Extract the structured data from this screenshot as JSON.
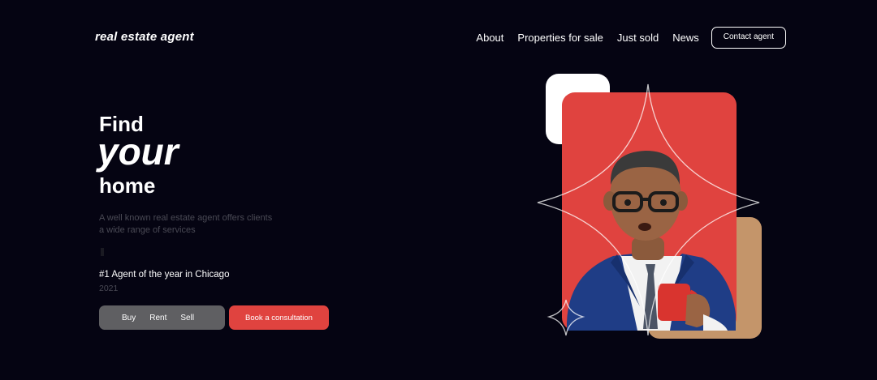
{
  "header": {
    "logo": "real estate agent",
    "nav": [
      "About",
      "Properties for sale",
      "Just sold",
      "News"
    ],
    "contact_label": "Contact agent"
  },
  "hero": {
    "line1": "Find",
    "line2": "your",
    "line3": "home",
    "description": "A well known real estate agent offers clients a wide range of services",
    "award": "#1 Agent of the year in Chicago",
    "award_year": "2021"
  },
  "filters": [
    "Buy",
    "Rent",
    "Sell"
  ],
  "cta_label": "Book a consultation",
  "colors": {
    "background": "#050412",
    "accent": "#e0433f",
    "filter_bg": "#5f5f62",
    "tan": "#c4956a"
  },
  "illustration": {
    "subject": "agent-avatar-with-mug"
  }
}
